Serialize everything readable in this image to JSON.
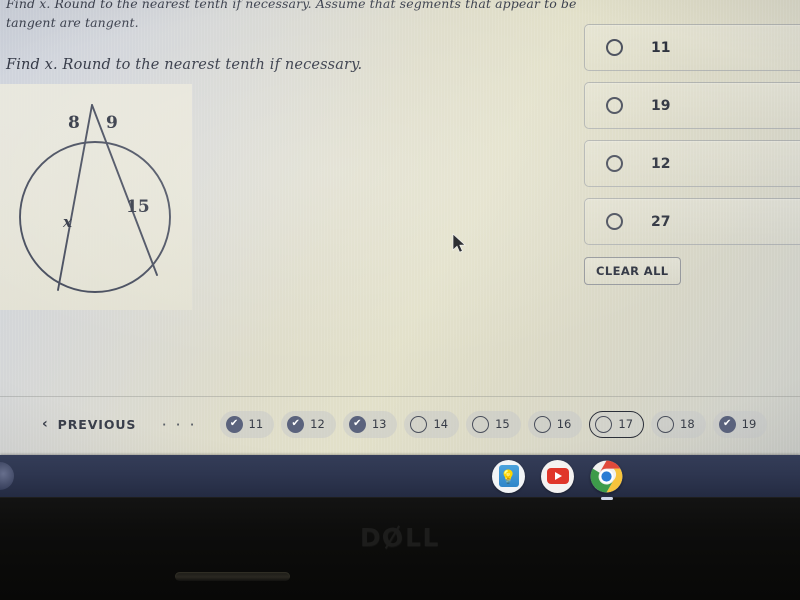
{
  "quiz": {
    "instruction_top": "Find x. Round to the nearest tenth if necessary. Assume that segments that appear to be tangent are tangent.",
    "question_prompt": "Find x. Round to the nearest tenth if necessary.",
    "figure": {
      "type": "circle-two-secants",
      "labels": {
        "external_left": "8",
        "external_right": "9",
        "chord_left": "x",
        "chord_right": "15"
      }
    },
    "options": [
      {
        "label": "11",
        "selected": false
      },
      {
        "label": "19",
        "selected": false
      },
      {
        "label": "12",
        "selected": false
      },
      {
        "label": "27",
        "selected": false
      }
    ],
    "clear_all_label": "CLEAR ALL"
  },
  "pager": {
    "previous_label": "PREVIOUS",
    "chevron": "‹",
    "ellipsis": "· · ·",
    "check_glyph": "✔",
    "chips": [
      {
        "number": "11",
        "state": "done"
      },
      {
        "number": "12",
        "state": "done"
      },
      {
        "number": "13",
        "state": "done"
      },
      {
        "number": "14",
        "state": "empty"
      },
      {
        "number": "15",
        "state": "empty"
      },
      {
        "number": "16",
        "state": "empty"
      },
      {
        "number": "17",
        "state": "current"
      },
      {
        "number": "18",
        "state": "empty"
      },
      {
        "number": "19",
        "state": "done"
      }
    ]
  },
  "shelf": {
    "apps": [
      {
        "name": "lightbulb-app",
        "glyph": "💡"
      },
      {
        "name": "youtube-app",
        "glyph": ""
      },
      {
        "name": "chrome-app",
        "glyph": ""
      }
    ]
  },
  "device": {
    "brand_prefix": "D",
    "brand_o": "Ø",
    "brand_suffix": "LL"
  },
  "colors": {
    "accent_chip": "#5b637d",
    "text_dark": "#2f3442",
    "shelf": "#2e3650",
    "bezel": "#0d0d0c"
  }
}
